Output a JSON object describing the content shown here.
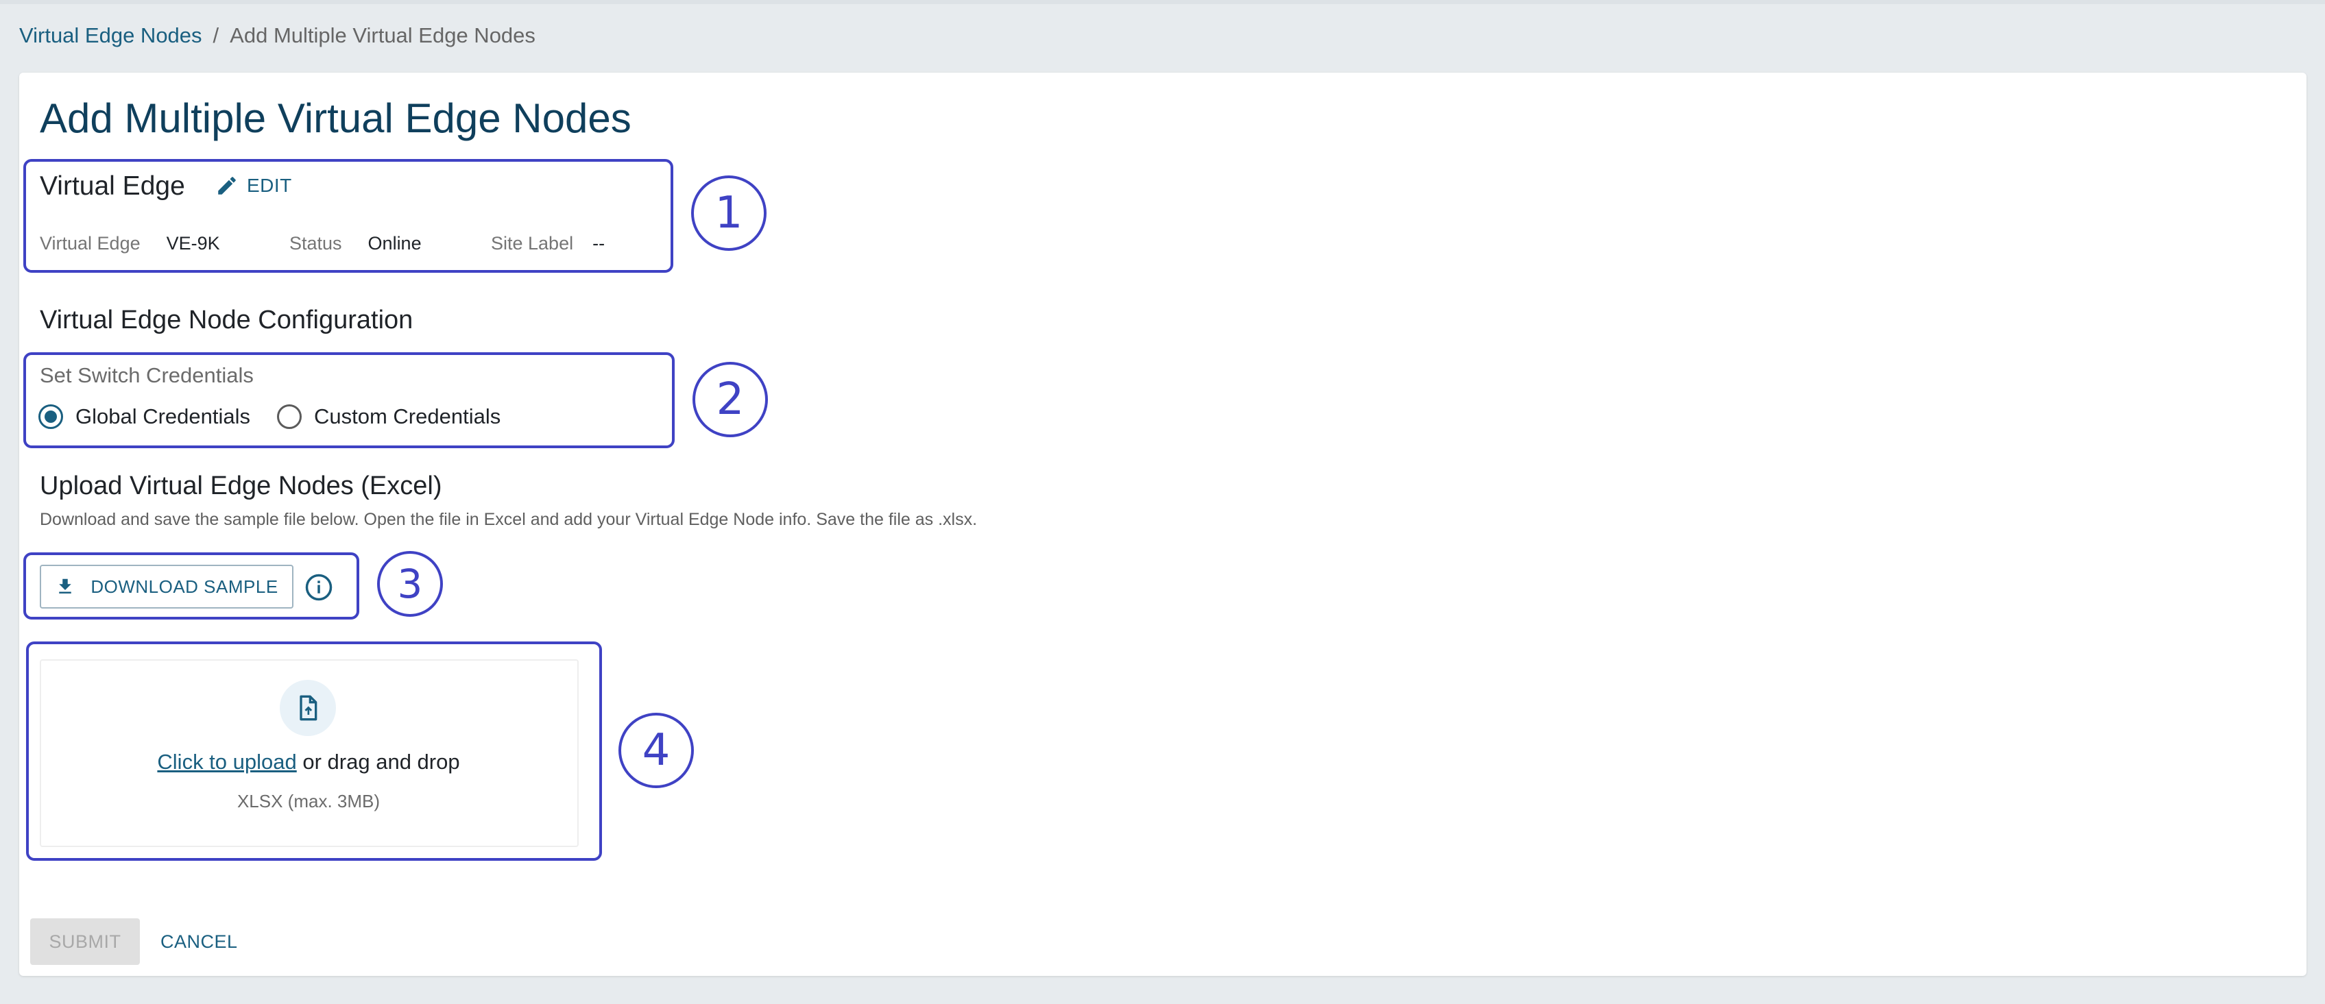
{
  "breadcrumb": {
    "parent": "Virtual Edge Nodes",
    "separator": "/",
    "current": "Add Multiple Virtual Edge Nodes"
  },
  "page": {
    "title": "Add Multiple Virtual Edge Nodes"
  },
  "virtual_edge": {
    "title": "Virtual Edge",
    "edit_label": "EDIT",
    "fields": [
      {
        "label": "Virtual Edge",
        "value": "VE-9K"
      },
      {
        "label": "Status",
        "value": "Online"
      },
      {
        "label": "Site Label",
        "value": "--"
      }
    ]
  },
  "configuration": {
    "heading": "Virtual Edge Node Configuration",
    "credentials_label": "Set Switch Credentials",
    "options": [
      {
        "label": "Global Credentials",
        "selected": true
      },
      {
        "label": "Custom Credentials",
        "selected": false
      }
    ]
  },
  "upload": {
    "heading": "Upload Virtual Edge Nodes (Excel)",
    "description": "Download and save the sample file below. Open the file in Excel and add your Virtual Edge Node info. Save the file as .xlsx.",
    "download_label": "DOWNLOAD SAMPLE",
    "click_label": "Click to upload",
    "drag_label": "or drag and drop",
    "hint": "XLSX (max. 3MB)"
  },
  "callouts": [
    "1",
    "2",
    "3",
    "4"
  ],
  "actions": {
    "submit_label": "SUBMIT",
    "cancel_label": "CANCEL"
  },
  "colors": {
    "primary": "#1a5f80",
    "title": "#0f3f5c",
    "callout": "#3f42c4",
    "background": "#e7ebee"
  },
  "icons": {
    "edit": "pencil-icon",
    "download": "download-icon",
    "info": "info-icon",
    "upload": "file-upload-icon"
  }
}
